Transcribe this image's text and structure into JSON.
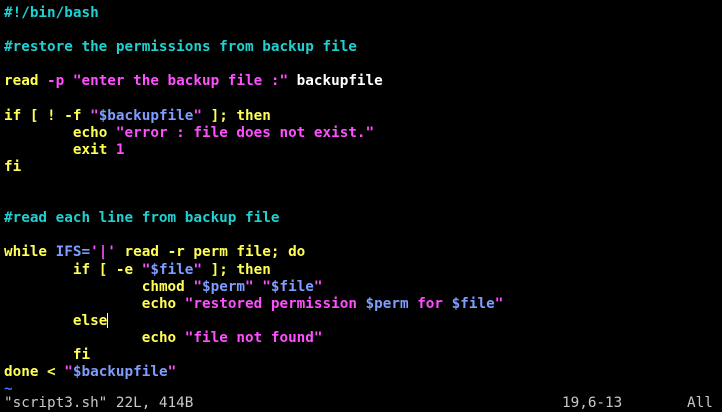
{
  "colors": {
    "background": "#000000",
    "plain": "#ffffff",
    "comment": "#1fd1d1",
    "keyword": "#ffff55",
    "string": "#ff4fff",
    "variable": "#7f9dff",
    "tilde": "#3b78ff"
  },
  "lines": [
    [
      {
        "t": "#!/bin/bash",
        "c": "comment"
      }
    ],
    [],
    [
      {
        "t": "#restore the permissions from backup file",
        "c": "comment"
      }
    ],
    [],
    [
      {
        "t": "read",
        "c": "keyword"
      },
      {
        "t": " ",
        "c": "plain"
      },
      {
        "t": "-p",
        "c": "string"
      },
      {
        "t": " ",
        "c": "plain"
      },
      {
        "t": "\"enter the backup file :\"",
        "c": "string"
      },
      {
        "t": " backupfile",
        "c": "plain"
      }
    ],
    [],
    [
      {
        "t": "if",
        "c": "keyword"
      },
      {
        "t": " ",
        "c": "plain"
      },
      {
        "t": "[ ! -f",
        "c": "keyword"
      },
      {
        "t": " ",
        "c": "plain"
      },
      {
        "t": "\"",
        "c": "string"
      },
      {
        "t": "$backupfile",
        "c": "variable"
      },
      {
        "t": "\"",
        "c": "string"
      },
      {
        "t": " ",
        "c": "plain"
      },
      {
        "t": "]; then",
        "c": "keyword"
      }
    ],
    [
      {
        "t": "        ",
        "c": "plain"
      },
      {
        "t": "echo",
        "c": "keyword"
      },
      {
        "t": " ",
        "c": "plain"
      },
      {
        "t": "\"error : file does not exist.\"",
        "c": "string"
      }
    ],
    [
      {
        "t": "        ",
        "c": "plain"
      },
      {
        "t": "exit",
        "c": "keyword"
      },
      {
        "t": " ",
        "c": "plain"
      },
      {
        "t": "1",
        "c": "string"
      }
    ],
    [
      {
        "t": "fi",
        "c": "keyword"
      }
    ],
    [],
    [],
    [
      {
        "t": "#read each line from backup file",
        "c": "comment"
      }
    ],
    [],
    [
      {
        "t": "while",
        "c": "keyword"
      },
      {
        "t": " ",
        "c": "plain"
      },
      {
        "t": "IFS=",
        "c": "variable"
      },
      {
        "t": "'|'",
        "c": "string"
      },
      {
        "t": " ",
        "c": "plain"
      },
      {
        "t": "read -r perm file; do",
        "c": "keyword"
      }
    ],
    [
      {
        "t": "        ",
        "c": "plain"
      },
      {
        "t": "if",
        "c": "keyword"
      },
      {
        "t": " ",
        "c": "plain"
      },
      {
        "t": "[ -e",
        "c": "keyword"
      },
      {
        "t": " ",
        "c": "plain"
      },
      {
        "t": "\"",
        "c": "string"
      },
      {
        "t": "$file",
        "c": "variable"
      },
      {
        "t": "\"",
        "c": "string"
      },
      {
        "t": " ",
        "c": "plain"
      },
      {
        "t": "]; then",
        "c": "keyword"
      }
    ],
    [
      {
        "t": "                ",
        "c": "plain"
      },
      {
        "t": "chmod",
        "c": "keyword"
      },
      {
        "t": " ",
        "c": "plain"
      },
      {
        "t": "\"",
        "c": "string"
      },
      {
        "t": "$perm",
        "c": "variable"
      },
      {
        "t": "\"",
        "c": "string"
      },
      {
        "t": " ",
        "c": "plain"
      },
      {
        "t": "\"",
        "c": "string"
      },
      {
        "t": "$file",
        "c": "variable"
      },
      {
        "t": "\"",
        "c": "string"
      }
    ],
    [
      {
        "t": "                ",
        "c": "plain"
      },
      {
        "t": "echo",
        "c": "keyword"
      },
      {
        "t": " ",
        "c": "plain"
      },
      {
        "t": "\"restored permission ",
        "c": "string"
      },
      {
        "t": "$perm",
        "c": "variable"
      },
      {
        "t": " for ",
        "c": "string"
      },
      {
        "t": "$file",
        "c": "variable"
      },
      {
        "t": "\"",
        "c": "string"
      }
    ],
    [
      {
        "t": "        ",
        "c": "plain"
      },
      {
        "t": "else",
        "c": "keyword"
      },
      {
        "t": "|cursor|",
        "c": "cursor"
      }
    ],
    [
      {
        "t": "                ",
        "c": "plain"
      },
      {
        "t": "echo",
        "c": "keyword"
      },
      {
        "t": " ",
        "c": "plain"
      },
      {
        "t": "\"file not found\"",
        "c": "string"
      }
    ],
    [
      {
        "t": "        ",
        "c": "plain"
      },
      {
        "t": "fi",
        "c": "keyword"
      }
    ],
    [
      {
        "t": "done",
        "c": "keyword"
      },
      {
        "t": " ",
        "c": "plain"
      },
      {
        "t": "<",
        "c": "keyword"
      },
      {
        "t": " ",
        "c": "plain"
      },
      {
        "t": "\"",
        "c": "string"
      },
      {
        "t": "$backupfile",
        "c": "variable"
      },
      {
        "t": "\"",
        "c": "string"
      }
    ],
    [
      {
        "t": "~",
        "c": "tilde"
      }
    ]
  ],
  "status": {
    "file_info": "\"script3.sh\" 22L, 414B",
    "position": "19,6-13",
    "scroll": "All"
  }
}
